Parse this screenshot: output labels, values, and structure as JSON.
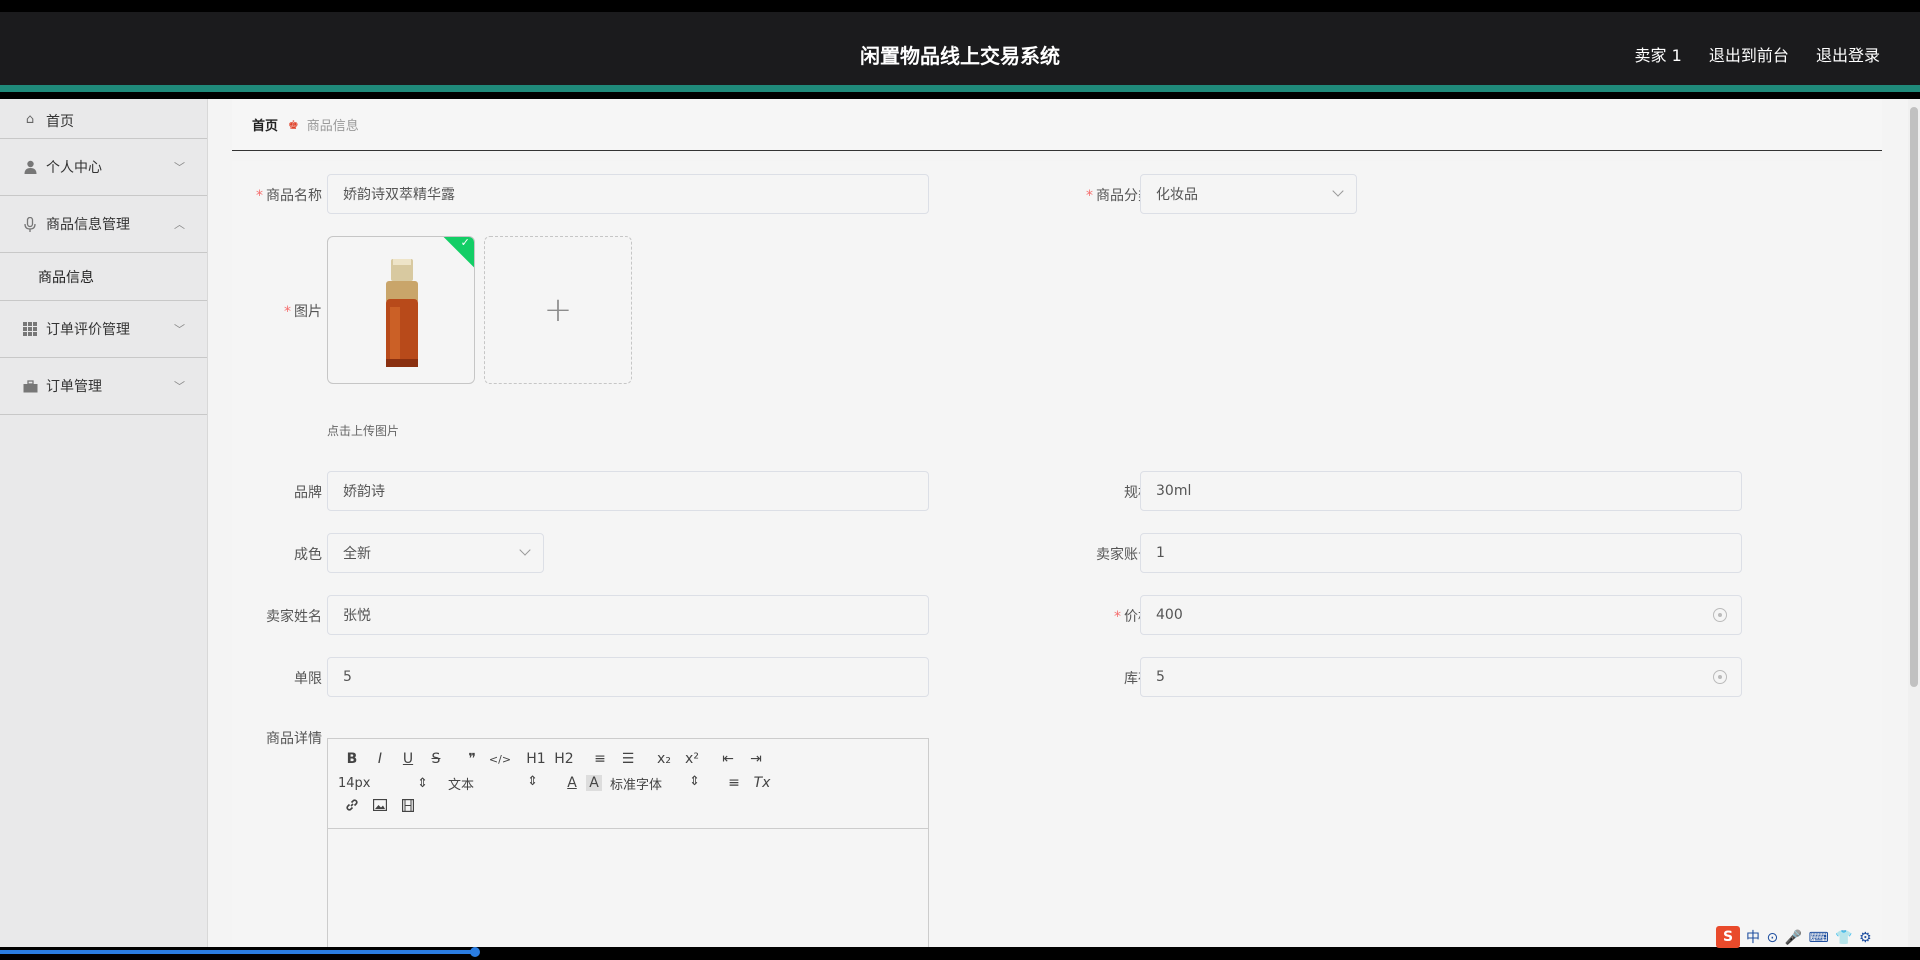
{
  "header": {
    "title": "闲置物品线上交易系统",
    "links": [
      "卖家 1",
      "退出到前台",
      "退出登录"
    ]
  },
  "sidebar": {
    "items": [
      {
        "label": "首页",
        "icon": "home-icon"
      },
      {
        "label": "个人中心",
        "icon": "user-icon"
      },
      {
        "label": "商品信息管理",
        "icon": "microphone-icon"
      },
      {
        "label": "订单评价管理",
        "icon": "grid-icon"
      },
      {
        "label": "订单管理",
        "icon": "briefcase-icon"
      }
    ],
    "submenu": {
      "label": "商品信息"
    }
  },
  "breadcrumb": {
    "home": "首页",
    "current": "商品信息"
  },
  "form": {
    "name_label": "商品名称",
    "name_value": "娇韵诗双萃精华露",
    "category_label": "商品分类",
    "category_value": "化妆品",
    "image_label": "图片",
    "upload_hint": "点击上传图片",
    "brand_label": "品牌",
    "brand_value": "娇韵诗",
    "spec_label": "规格",
    "spec_value": "30ml",
    "condition_label": "成色",
    "condition_value": "全新",
    "seller_account_label": "卖家账号",
    "seller_account_value": "1",
    "seller_name_label": "卖家姓名",
    "seller_name_value": "张悦",
    "price_label": "价格",
    "price_value": "400",
    "limit_label": "单限",
    "limit_value": "5",
    "stock_label": "库存",
    "stock_value": "5",
    "detail_label": "商品详情"
  },
  "editor": {
    "row1": [
      "B",
      "I",
      "U",
      "S",
      "❞",
      "</>",
      "H1",
      "H2",
      "≡",
      "☰",
      "x₂",
      "x²",
      "⇤",
      "⇥"
    ],
    "font_size": "14px",
    "text_type": "文本",
    "font_family": "标准字体",
    "row2_tail": [
      "A",
      "A",
      "≡",
      "Tx"
    ]
  },
  "ime": {
    "badge": "S",
    "text": "中 ⊙ 🎤 ⌨ 👕 ⚙"
  },
  "colors": {
    "accent": "#1f8a7a",
    "header_bg": "#1b1b1d",
    "required": "#f56c6c",
    "success": "#13ce66"
  }
}
